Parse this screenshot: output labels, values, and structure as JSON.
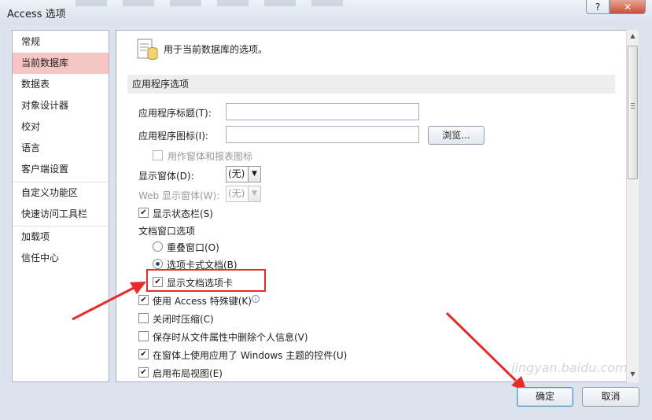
{
  "window": {
    "title": "Access 选项",
    "help_label": "?",
    "close_label": "✕"
  },
  "nav": {
    "items": [
      {
        "label": "常规"
      },
      {
        "label": "当前数据库"
      },
      {
        "label": "数据表"
      },
      {
        "label": "对象设计器"
      },
      {
        "label": "校对"
      },
      {
        "label": "语言"
      },
      {
        "label": "客户端设置"
      },
      {
        "label": "自定义功能区"
      },
      {
        "label": "快速访问工具栏"
      },
      {
        "label": "加载项"
      },
      {
        "label": "信任中心"
      }
    ],
    "active_index": 1
  },
  "content": {
    "header_text": "用于当前数据库的选项。",
    "section_title": "应用程序选项",
    "app_title_label": "应用程序标题(T):",
    "app_title_value": "",
    "app_icon_label": "应用程序图标(I):",
    "app_icon_value": "",
    "browse_label": "浏览...",
    "use_as_form_icon_label": "用作窗体和报表图标",
    "display_form_label": "显示窗体(D):",
    "display_form_value": "(无)",
    "web_display_form_label": "Web 显示窗体(W):",
    "web_display_form_value": "(无)",
    "status_bar_label": "显示状态栏(S)",
    "doc_window_options_label": "文档窗口选项",
    "overlapping_windows_label": "重叠窗口(O)",
    "tabbed_documents_label": "选项卡式文档(B)",
    "display_doc_tabs_label": "显示文档选项卡",
    "access_special_keys_label": "使用 Access 特殊键(K)",
    "compact_on_close_label": "关闭时压缩(C)",
    "remove_personal_info_label": "保存时从文件属性中删除个人信息(V)",
    "windows_themed_controls_label": "在窗体上使用应用了 Windows 主题的控件(U)",
    "enable_layout_view_label": "启用布局视图(E)",
    "info_icon_glyph": "i",
    "checked_glyph": "✔",
    "dropdown_glyph": "▼"
  },
  "state": {
    "use_as_form_icon_checked": false,
    "status_bar_checked": true,
    "overlapping_windows_selected": false,
    "tabbed_documents_selected": true,
    "display_doc_tabs_checked": true,
    "access_special_keys_checked": true,
    "compact_on_close_checked": false,
    "remove_personal_info_checked": false,
    "windows_themed_controls_checked": true,
    "enable_layout_view_checked": true
  },
  "scrollbar": {
    "up_arrow": "▲",
    "down_arrow": "▼"
  },
  "footer": {
    "ok_label": "确定",
    "cancel_label": "取消"
  },
  "watermark_text": "jingyan.baidu.com",
  "annotation_color": "#e52b2b"
}
